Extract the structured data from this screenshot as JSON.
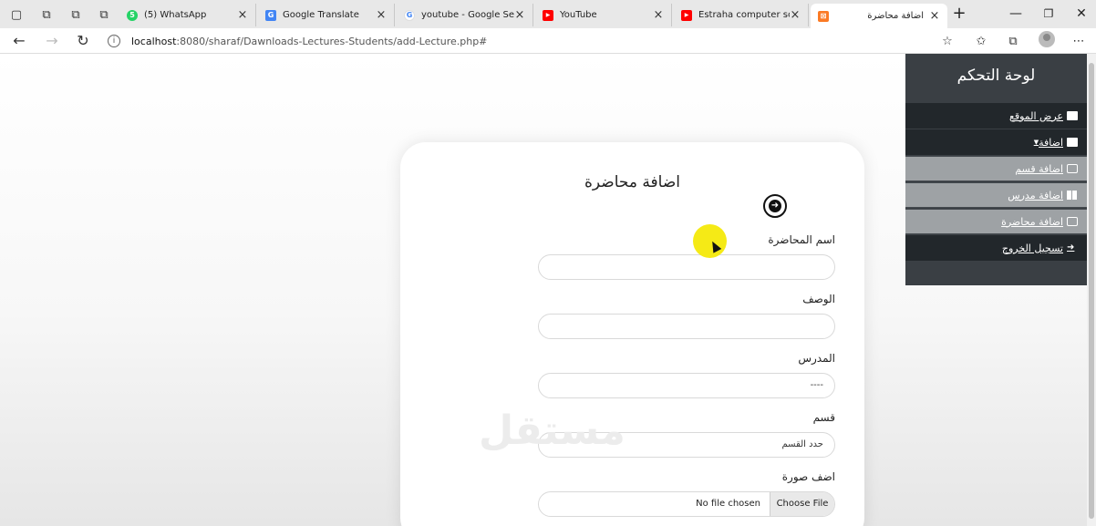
{
  "browser": {
    "tabs": [
      {
        "title": "(5) WhatsApp",
        "favicon_color": "#25d366",
        "favicon_char": "5"
      },
      {
        "title": "Google Translate",
        "favicon_color": "#4285f4",
        "favicon_char": "G"
      },
      {
        "title": "youtube - Google Search",
        "favicon_color": "#ffffff",
        "favicon_char": "G"
      },
      {
        "title": "YouTube",
        "favicon_color": "#ff0000",
        "favicon_char": "▶"
      },
      {
        "title": "Estraha computer science",
        "favicon_color": "#ff0000",
        "favicon_char": "▶"
      },
      {
        "title": "اضافة محاضرة",
        "favicon_color": "#fb7a24",
        "favicon_char": "⊠"
      }
    ],
    "new_tab_label": "+",
    "url_host": "localhost",
    "url_rest": ":8080/sharaf/Dawnloads-Lectures-Students/add-Lecture.php#"
  },
  "sidebar": {
    "title": "لوحة التحكم",
    "items": [
      {
        "label": "عرض الموقع",
        "icon": "window-icon"
      },
      {
        "label": "اضافة",
        "icon": "card-icon"
      },
      {
        "label": "اضافة قسم",
        "icon": "edit-icon"
      },
      {
        "label": "اضافة مدرس",
        "icon": "grid-icon"
      },
      {
        "label": "اضافة محاضرة",
        "icon": "edit-icon"
      },
      {
        "label": "تسجيل الخروج",
        "icon": "sign-out-icon"
      }
    ]
  },
  "form": {
    "title": "اضافة محاضرة",
    "lecture_name_label": "اسم المحاضرة",
    "lecture_name_value": "",
    "description_label": "الوصف",
    "description_value": "",
    "teacher_label": "المدرس",
    "teacher_value": "----",
    "section_label": "قسم",
    "section_value": "حدد القسم",
    "image_label": "اضف صورة",
    "file_status": "No file chosen",
    "file_button": "Choose File"
  },
  "watermark": "مستقل"
}
